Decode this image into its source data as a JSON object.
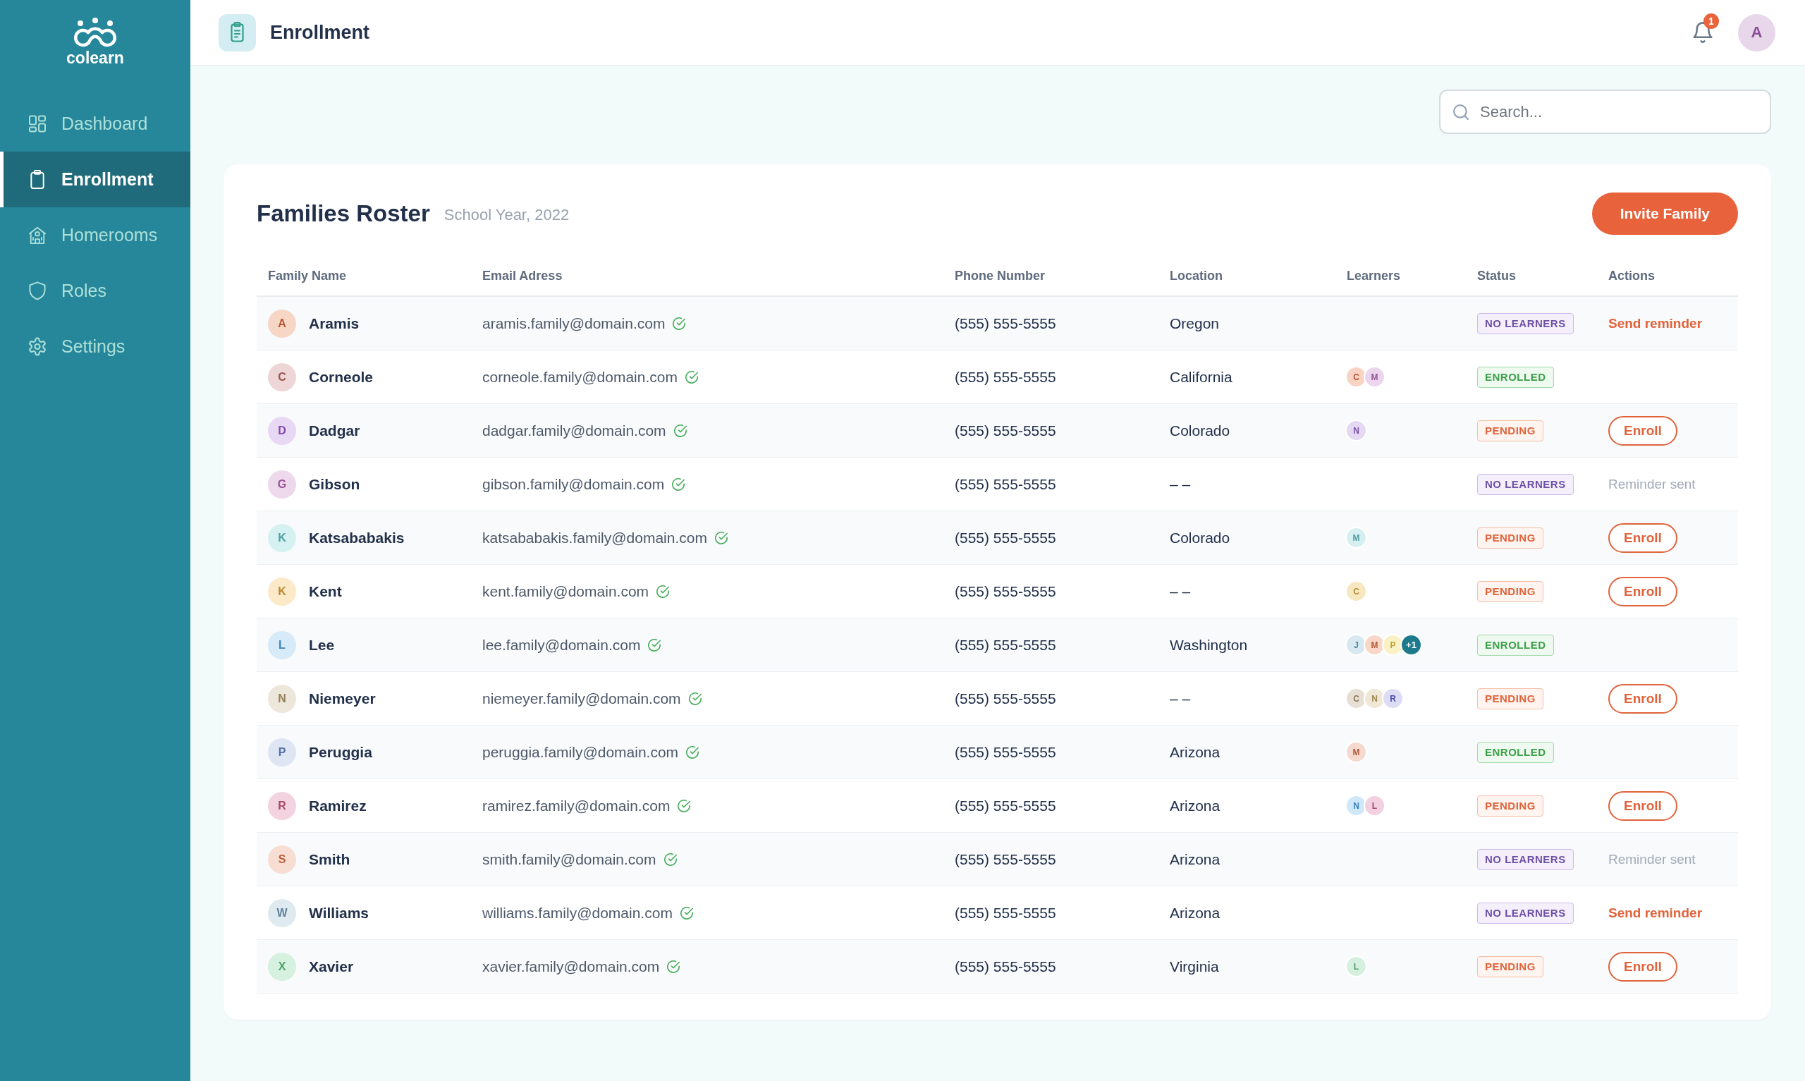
{
  "sidebar": {
    "logo_text": "colearn",
    "items": [
      {
        "label": "Dashboard",
        "selected": false
      },
      {
        "label": "Enrollment",
        "selected": true
      },
      {
        "label": "Homerooms",
        "selected": false
      },
      {
        "label": "Roles",
        "selected": false
      },
      {
        "label": "Settings",
        "selected": false
      }
    ]
  },
  "header": {
    "title": "Enrollment",
    "notification_count": "1",
    "user_initial": "A"
  },
  "search": {
    "placeholder": "Search..."
  },
  "roster": {
    "title": "Families Roster",
    "subtitle": "School Year, 2022",
    "invite_button": "Invite Family",
    "table": {
      "columns": [
        "Family Name",
        "Email Adress",
        "Phone Number",
        "Location",
        "Learners",
        "Status",
        "Actions"
      ],
      "rows": [
        {
          "initial": "A",
          "color": "#f8d6c6",
          "name": "Aramis",
          "email": "aramis.family@domain.com",
          "email_verified": true,
          "phone": "(555) 555-5555",
          "location": "Oregon",
          "status": {
            "kind": "no_learners",
            "label": "NO LEARNERS"
          },
          "action": {
            "kind": "link",
            "label": "Send reminder"
          }
        },
        {
          "initial": "C",
          "color": "#eed6d6",
          "name": "Corneole",
          "email": "corneole.family@domain.com",
          "email_verified": true,
          "phone": "(555) 555-5555",
          "location": "California",
          "learners": [
            {
              "initial": "C",
              "color": "#f8d3c4"
            },
            {
              "initial": "M",
              "color": "#ecd6ee"
            }
          ],
          "status": {
            "kind": "enrolled",
            "label": "ENROLLED"
          }
        },
        {
          "initial": "D",
          "color": "#e8d8f4",
          "name": "Dadgar",
          "email": "dadgar.family@domain.com",
          "email_verified": true,
          "phone": "(555) 555-5555",
          "location": "Colorado",
          "learners": [
            {
              "initial": "N",
              "color": "#e4d8f2"
            }
          ],
          "status": {
            "kind": "pending",
            "label": "PENDING"
          },
          "action": {
            "kind": "button",
            "label": "Enroll"
          }
        },
        {
          "initial": "G",
          "color": "#eed8ec",
          "name": "Gibson",
          "email": "gibson.family@domain.com",
          "email_verified": true,
          "phone": "(555) 555-5555",
          "location": "– –",
          "status": {
            "kind": "no_learners",
            "label": "NO LEARNERS"
          },
          "action": {
            "kind": "text",
            "label": "Reminder sent"
          }
        },
        {
          "initial": "K",
          "color": "#d6f1f1",
          "name": "Katsababakis",
          "email": "katsababakis.family@domain.com",
          "email_verified": true,
          "phone": "(555) 555-5555",
          "location": "Colorado",
          "learners": [
            {
              "initial": "M",
              "color": "#d6eff1"
            }
          ],
          "status": {
            "kind": "pending",
            "label": "PENDING"
          },
          "action": {
            "kind": "button",
            "label": "Enroll"
          }
        },
        {
          "initial": "K",
          "color": "#fbe9c8",
          "name": "Kent",
          "email": "kent.family@domain.com",
          "email_verified": true,
          "phone": "(555) 555-5555",
          "location": "– –",
          "learners": [
            {
              "initial": "C",
              "color": "#f8e8c2"
            }
          ],
          "status": {
            "kind": "pending",
            "label": "PENDING"
          },
          "action": {
            "kind": "button",
            "label": "Enroll"
          }
        },
        {
          "initial": "L",
          "color": "#d6eaf8",
          "name": "Lee",
          "email": "lee.family@domain.com",
          "email_verified": true,
          "phone": "(555) 555-5555",
          "location": "Washington",
          "learners": [
            {
              "initial": "J",
              "color": "#d8e8f0"
            },
            {
              "initial": "M",
              "color": "#f8d6c8"
            },
            {
              "initial": "P",
              "color": "#fbf1c6"
            }
          ],
          "learners_more": "+1",
          "status": {
            "kind": "enrolled",
            "label": "ENROLLED"
          }
        },
        {
          "initial": "N",
          "color": "#ede6da",
          "name": "Niemeyer",
          "email": "niemeyer.family@domain.com",
          "email_verified": true,
          "phone": "(555) 555-5555",
          "location": "– –",
          "learners": [
            {
              "initial": "C",
              "color": "#e8dfd4"
            },
            {
              "initial": "N",
              "color": "#f0e8d6"
            },
            {
              "initial": "R",
              "color": "#dcdcf5"
            }
          ],
          "status": {
            "kind": "pending",
            "label": "PENDING"
          },
          "action": {
            "kind": "button",
            "label": "Enroll"
          }
        },
        {
          "initial": "P",
          "color": "#dee5f3",
          "name": "Peruggia",
          "email": "peruggia.family@domain.com",
          "email_verified": true,
          "phone": "(555) 555-5555",
          "location": "Arizona",
          "learners": [
            {
              "initial": "M",
              "color": "#f5d8ce"
            }
          ],
          "status": {
            "kind": "enrolled",
            "label": "ENROLLED"
          }
        },
        {
          "initial": "R",
          "color": "#f3d3df",
          "name": "Ramirez",
          "email": "ramirez.family@domain.com",
          "email_verified": true,
          "phone": "(555) 555-5555",
          "location": "Arizona",
          "learners": [
            {
              "initial": "N",
              "color": "#cfe7f8"
            },
            {
              "initial": "L",
              "color": "#f2d0e0"
            }
          ],
          "status": {
            "kind": "pending",
            "label": "PENDING"
          },
          "action": {
            "kind": "button",
            "label": "Enroll"
          }
        },
        {
          "initial": "S",
          "color": "#f8ddd2",
          "name": "Smith",
          "email": "smith.family@domain.com",
          "email_verified": true,
          "phone": "(555) 555-5555",
          "location": "Arizona",
          "status": {
            "kind": "no_learners",
            "label": "NO LEARNERS"
          },
          "action": {
            "kind": "text",
            "label": "Reminder sent"
          }
        },
        {
          "initial": "W",
          "color": "#dfe9f0",
          "name": "Williams",
          "email": "williams.family@domain.com",
          "email_verified": true,
          "phone": "(555) 555-5555",
          "location": "Arizona",
          "status": {
            "kind": "no_learners",
            "label": "NO LEARNERS"
          },
          "action": {
            "kind": "link",
            "label": "Send reminder"
          }
        },
        {
          "initial": "X",
          "color": "#d6f1df",
          "name": "Xavier",
          "email": "xavier.family@domain.com",
          "email_verified": true,
          "phone": "(555) 555-5555",
          "location": "Virginia",
          "learners": [
            {
              "initial": "L",
              "color": "#d6f0df"
            }
          ],
          "status": {
            "kind": "pending",
            "label": "PENDING"
          },
          "action": {
            "kind": "button",
            "label": "Enroll"
          }
        }
      ]
    }
  }
}
